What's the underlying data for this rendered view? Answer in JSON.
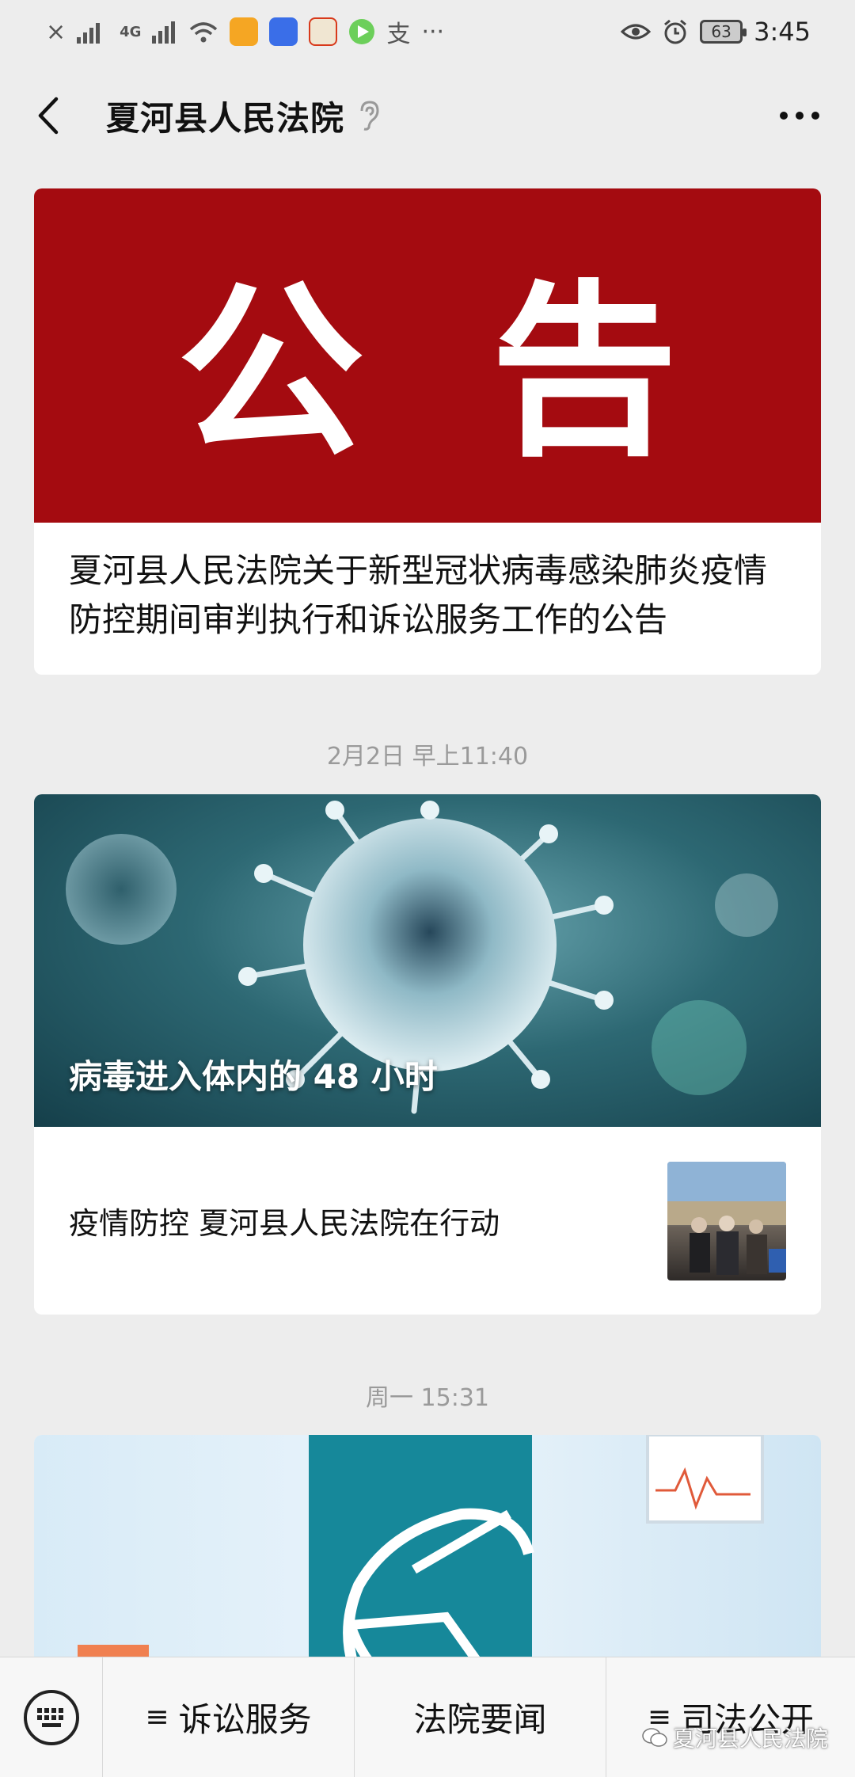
{
  "status_bar": {
    "left_glyphs": [
      "×",
      "4G",
      "支",
      "···"
    ],
    "battery": "63",
    "time": "3:45"
  },
  "header": {
    "title": "夏河县人民法院"
  },
  "cards": [
    {
      "banner_text": [
        "公",
        "告"
      ],
      "title": "夏河县人民法院关于新型冠状病毒感染肺炎疫情防控期间审判执行和诉讼服务工作的公告"
    }
  ],
  "timestamps": [
    "2月2日 早上11:40",
    "周一 15:31"
  ],
  "card2": {
    "banner_caption": "病毒进入体内的 48 小时",
    "sub_title": "疫情防控  夏河县人民法院在行动"
  },
  "bottom_menu": {
    "items": [
      {
        "label": "诉讼服务",
        "icon": "≡"
      },
      {
        "label": "法院要闻",
        "icon": ""
      },
      {
        "label": "司法公开",
        "icon": "≡"
      }
    ]
  },
  "watermark": "夏河县人民法院",
  "colors": {
    "banner_red": "#a40b10",
    "teal": "#16889a",
    "background": "#ededed"
  }
}
